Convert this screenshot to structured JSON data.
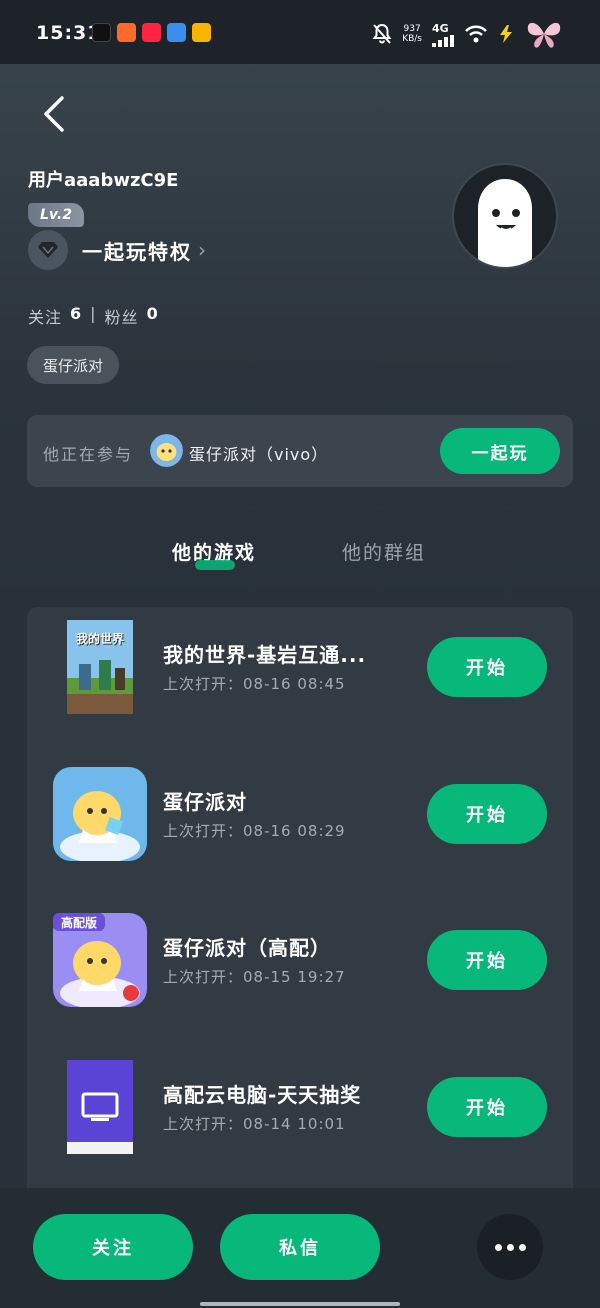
{
  "status_bar": {
    "time": "15:31",
    "speed_value": "937",
    "speed_unit": "KB/s",
    "network": "4G"
  },
  "profile": {
    "username": "用户aaabwzC9E",
    "level": "Lv.2",
    "vip_label": "一起玩特权",
    "follow_label": "关注",
    "follow_count": "6",
    "fans_label": "粉丝",
    "fans_count": "0",
    "tag": "蛋仔派对"
  },
  "playing": {
    "prefix": "他正在参与",
    "game": "蛋仔派对（vivo）",
    "button": "一起玩"
  },
  "tabs": {
    "active": "他的游戏",
    "inactive": "他的群组"
  },
  "games": [
    {
      "title": "我的世界-基岩互通...",
      "time": "上次打开：08-16 08:45",
      "button": "开始"
    },
    {
      "title": "蛋仔派对",
      "time": "上次打开：08-16 08:29",
      "button": "开始"
    },
    {
      "title": "蛋仔派对（高配）",
      "time": "上次打开：08-15 19:27",
      "button": "开始"
    },
    {
      "title": "高配云电脑-天天抽奖",
      "time": "上次打开：08-14 10:01",
      "button": "开始"
    }
  ],
  "game_thumb_text": {
    "minecraft": "我的世界",
    "high_badge": "高配版"
  },
  "bottom": {
    "follow": "关注",
    "message": "私信"
  },
  "colors": {
    "accent": "#07b87a",
    "background": "#28313a",
    "panel": "#323b43"
  }
}
